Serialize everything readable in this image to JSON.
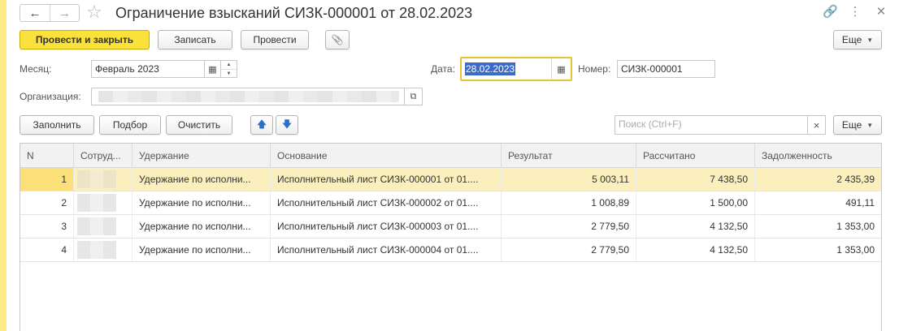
{
  "window": {
    "title": "Ограничение взысканий СИЗК-000001 от 28.02.2023",
    "nav_back": "←",
    "nav_forward": "→",
    "favorite_glyph": "☆",
    "icons": {
      "link": "🔗",
      "more": "⋮",
      "close": "✕"
    }
  },
  "toolbar": {
    "post_close_label": "Провести и закрыть",
    "save_label": "Записать",
    "post_label": "Провести",
    "attach_glyph": "📎",
    "more_label": "Еще"
  },
  "form": {
    "month_label": "Месяц:",
    "month_value": "Февраль 2023",
    "date_label": "Дата:",
    "date_value": "28.02.2023",
    "number_label": "Номер:",
    "number_value": "СИЗК-000001",
    "organization_label": "Организация:"
  },
  "table_toolbar": {
    "fill_label": "Заполнить",
    "select_label": "Подбор",
    "clear_label": "Очистить",
    "up_glyph": "🡅",
    "down_glyph": "🡇",
    "search_placeholder": "Поиск (Ctrl+F)",
    "search_clear": "×",
    "more_label": "Еще"
  },
  "table": {
    "columns": [
      "N",
      "Сотруд...",
      "Удержание",
      "Основание",
      "Результат",
      "Рассчитано",
      "Задолженность"
    ],
    "rows": [
      {
        "n": "1",
        "deduction": "Удержание по исполни...",
        "basis": "Исполнительный лист СИЗК-000001 от 01....",
        "result": "5 003,11",
        "calculated": "7 438,50",
        "debt": "2 435,39"
      },
      {
        "n": "2",
        "deduction": "Удержание по исполни...",
        "basis": "Исполнительный лист СИЗК-000002 от 01....",
        "result": "1 008,89",
        "calculated": "1 500,00",
        "debt": "491,11"
      },
      {
        "n": "3",
        "deduction": "Удержание по исполни...",
        "basis": "Исполнительный лист СИЗК-000003 от 01....",
        "result": "2 779,50",
        "calculated": "4 132,50",
        "debt": "1 353,00"
      },
      {
        "n": "4",
        "deduction": "Удержание по исполни...",
        "basis": "Исполнительный лист СИЗК-000004 от 01....",
        "result": "2 779,50",
        "calculated": "4 132,50",
        "debt": "1 353,00"
      }
    ]
  },
  "colors": {
    "primary_button": "#fbe23a",
    "selected_row": "#fbefbd",
    "date_focus_border": "#e6c434",
    "selection_highlight": "#3a6bc9"
  }
}
